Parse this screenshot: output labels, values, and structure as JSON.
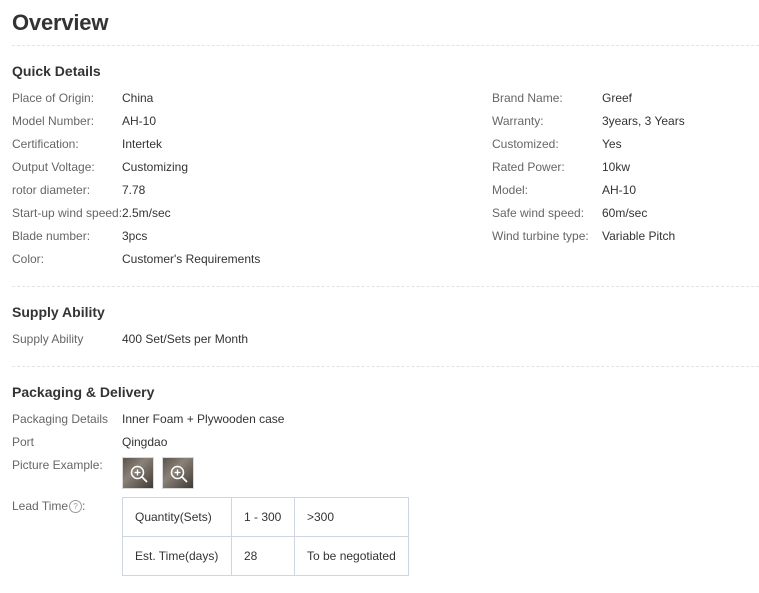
{
  "page": {
    "title": "Overview"
  },
  "quick_details": {
    "title": "Quick Details",
    "left": [
      {
        "label": "Place of Origin:",
        "value": "China"
      },
      {
        "label": "Model Number:",
        "value": "AH-10"
      },
      {
        "label": "Certification:",
        "value": "Intertek"
      },
      {
        "label": "Output Voltage:",
        "value": "Customizing"
      },
      {
        "label": "rotor diameter:",
        "value": "7.78"
      },
      {
        "label": "Start-up wind speed:",
        "value": "2.5m/sec"
      },
      {
        "label": "Blade number:",
        "value": "3pcs"
      },
      {
        "label": "Color:",
        "value": "Customer's Requirements"
      }
    ],
    "right": [
      {
        "label": "Brand Name:",
        "value": "Greef"
      },
      {
        "label": "Warranty:",
        "value": "3years, 3 Years"
      },
      {
        "label": "Customized:",
        "value": "Yes"
      },
      {
        "label": "Rated Power:",
        "value": "10kw"
      },
      {
        "label": "Model:",
        "value": "AH-10"
      },
      {
        "label": "Safe wind speed:",
        "value": "60m/sec"
      },
      {
        "label": "Wind turbine type:",
        "value": "Variable Pitch"
      }
    ]
  },
  "supply_ability": {
    "title": "Supply Ability",
    "label": "Supply Ability",
    "value": "400 Set/Sets per Month"
  },
  "packaging": {
    "title": "Packaging & Delivery",
    "details_label": "Packaging Details",
    "details_value": "Inner Foam + Plywooden case",
    "port_label": "Port",
    "port_value": "Qingdao",
    "picture_label": "Picture Example:",
    "thumbnail_icon": "zoom-in-icon",
    "lead_time_label": "Lead Time",
    "lead_time_suffix": ":",
    "help_icon": "question-icon",
    "help_glyph": "?",
    "lead_table": [
      [
        "Quantity(Sets)",
        "1 - 300",
        ">300"
      ],
      [
        "Est. Time(days)",
        "28",
        "To be negotiated"
      ]
    ]
  }
}
